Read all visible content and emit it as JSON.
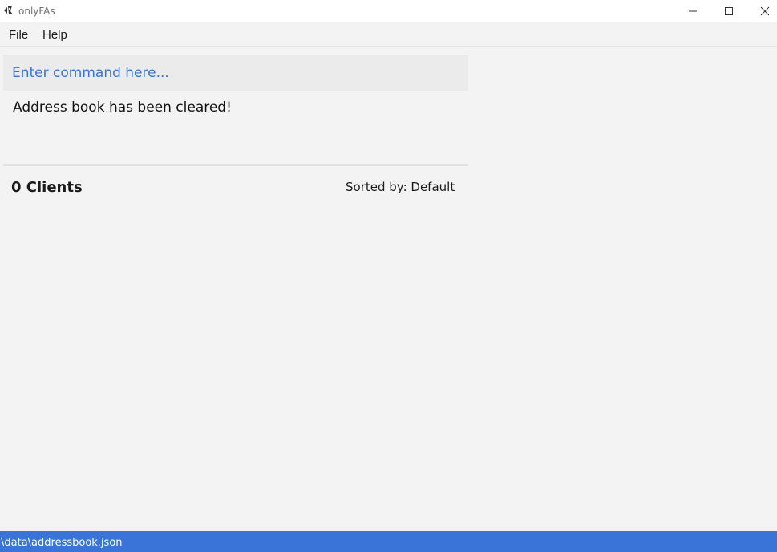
{
  "window": {
    "title": "onlyFAs",
    "app_icon": "app-logo-icon",
    "controls": {
      "minimize_icon": "minimize-icon",
      "maximize_icon": "maximize-icon",
      "close_icon": "close-icon"
    }
  },
  "menu": {
    "items": [
      {
        "label": "File"
      },
      {
        "label": "Help"
      }
    ]
  },
  "command": {
    "placeholder": "Enter command here...",
    "value": ""
  },
  "result": {
    "message": "Address book has been cleared!"
  },
  "client_list": {
    "count_label": "0 Clients",
    "sort_label": "Sorted by: Default",
    "items": []
  },
  "status": {
    "file_path": "\\data\\addressbook.json"
  },
  "colors": {
    "accent": "#3a74d8",
    "placeholder": "#3b72d4",
    "background": "#f3f3f3",
    "command_background": "#ebebeb"
  }
}
